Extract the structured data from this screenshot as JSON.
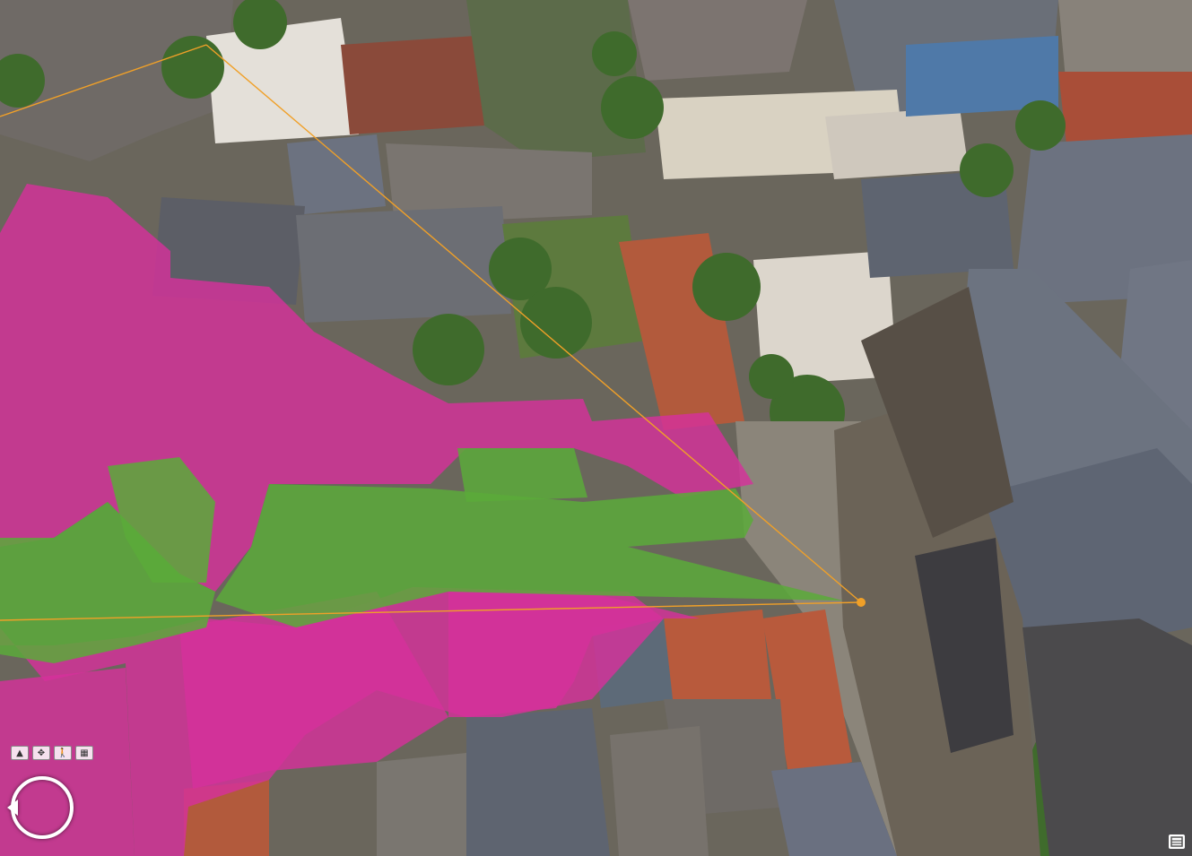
{
  "map": {
    "view_type": "3d-oblique-aerial",
    "colors": {
      "shadow_zone": "#d6319b",
      "visible_zone": "#5aaa3a",
      "sight_line": "#f0a028",
      "roof_red": "#b85a3c",
      "roof_gray": "#6c7380",
      "tree": "#3f6b2c",
      "pavement": "#8b857a"
    }
  },
  "controls": {
    "buttons": [
      {
        "name": "tilt-up-button",
        "icon": "caret-up-icon"
      },
      {
        "name": "expand-button",
        "icon": "expand-icon"
      },
      {
        "name": "walk-mode-button",
        "icon": "person-walk-icon"
      },
      {
        "name": "options-button",
        "icon": "grid-icon"
      }
    ],
    "nav_icon": "rotate-navigation-icon",
    "bottom_right_icon": "layers-icon"
  }
}
